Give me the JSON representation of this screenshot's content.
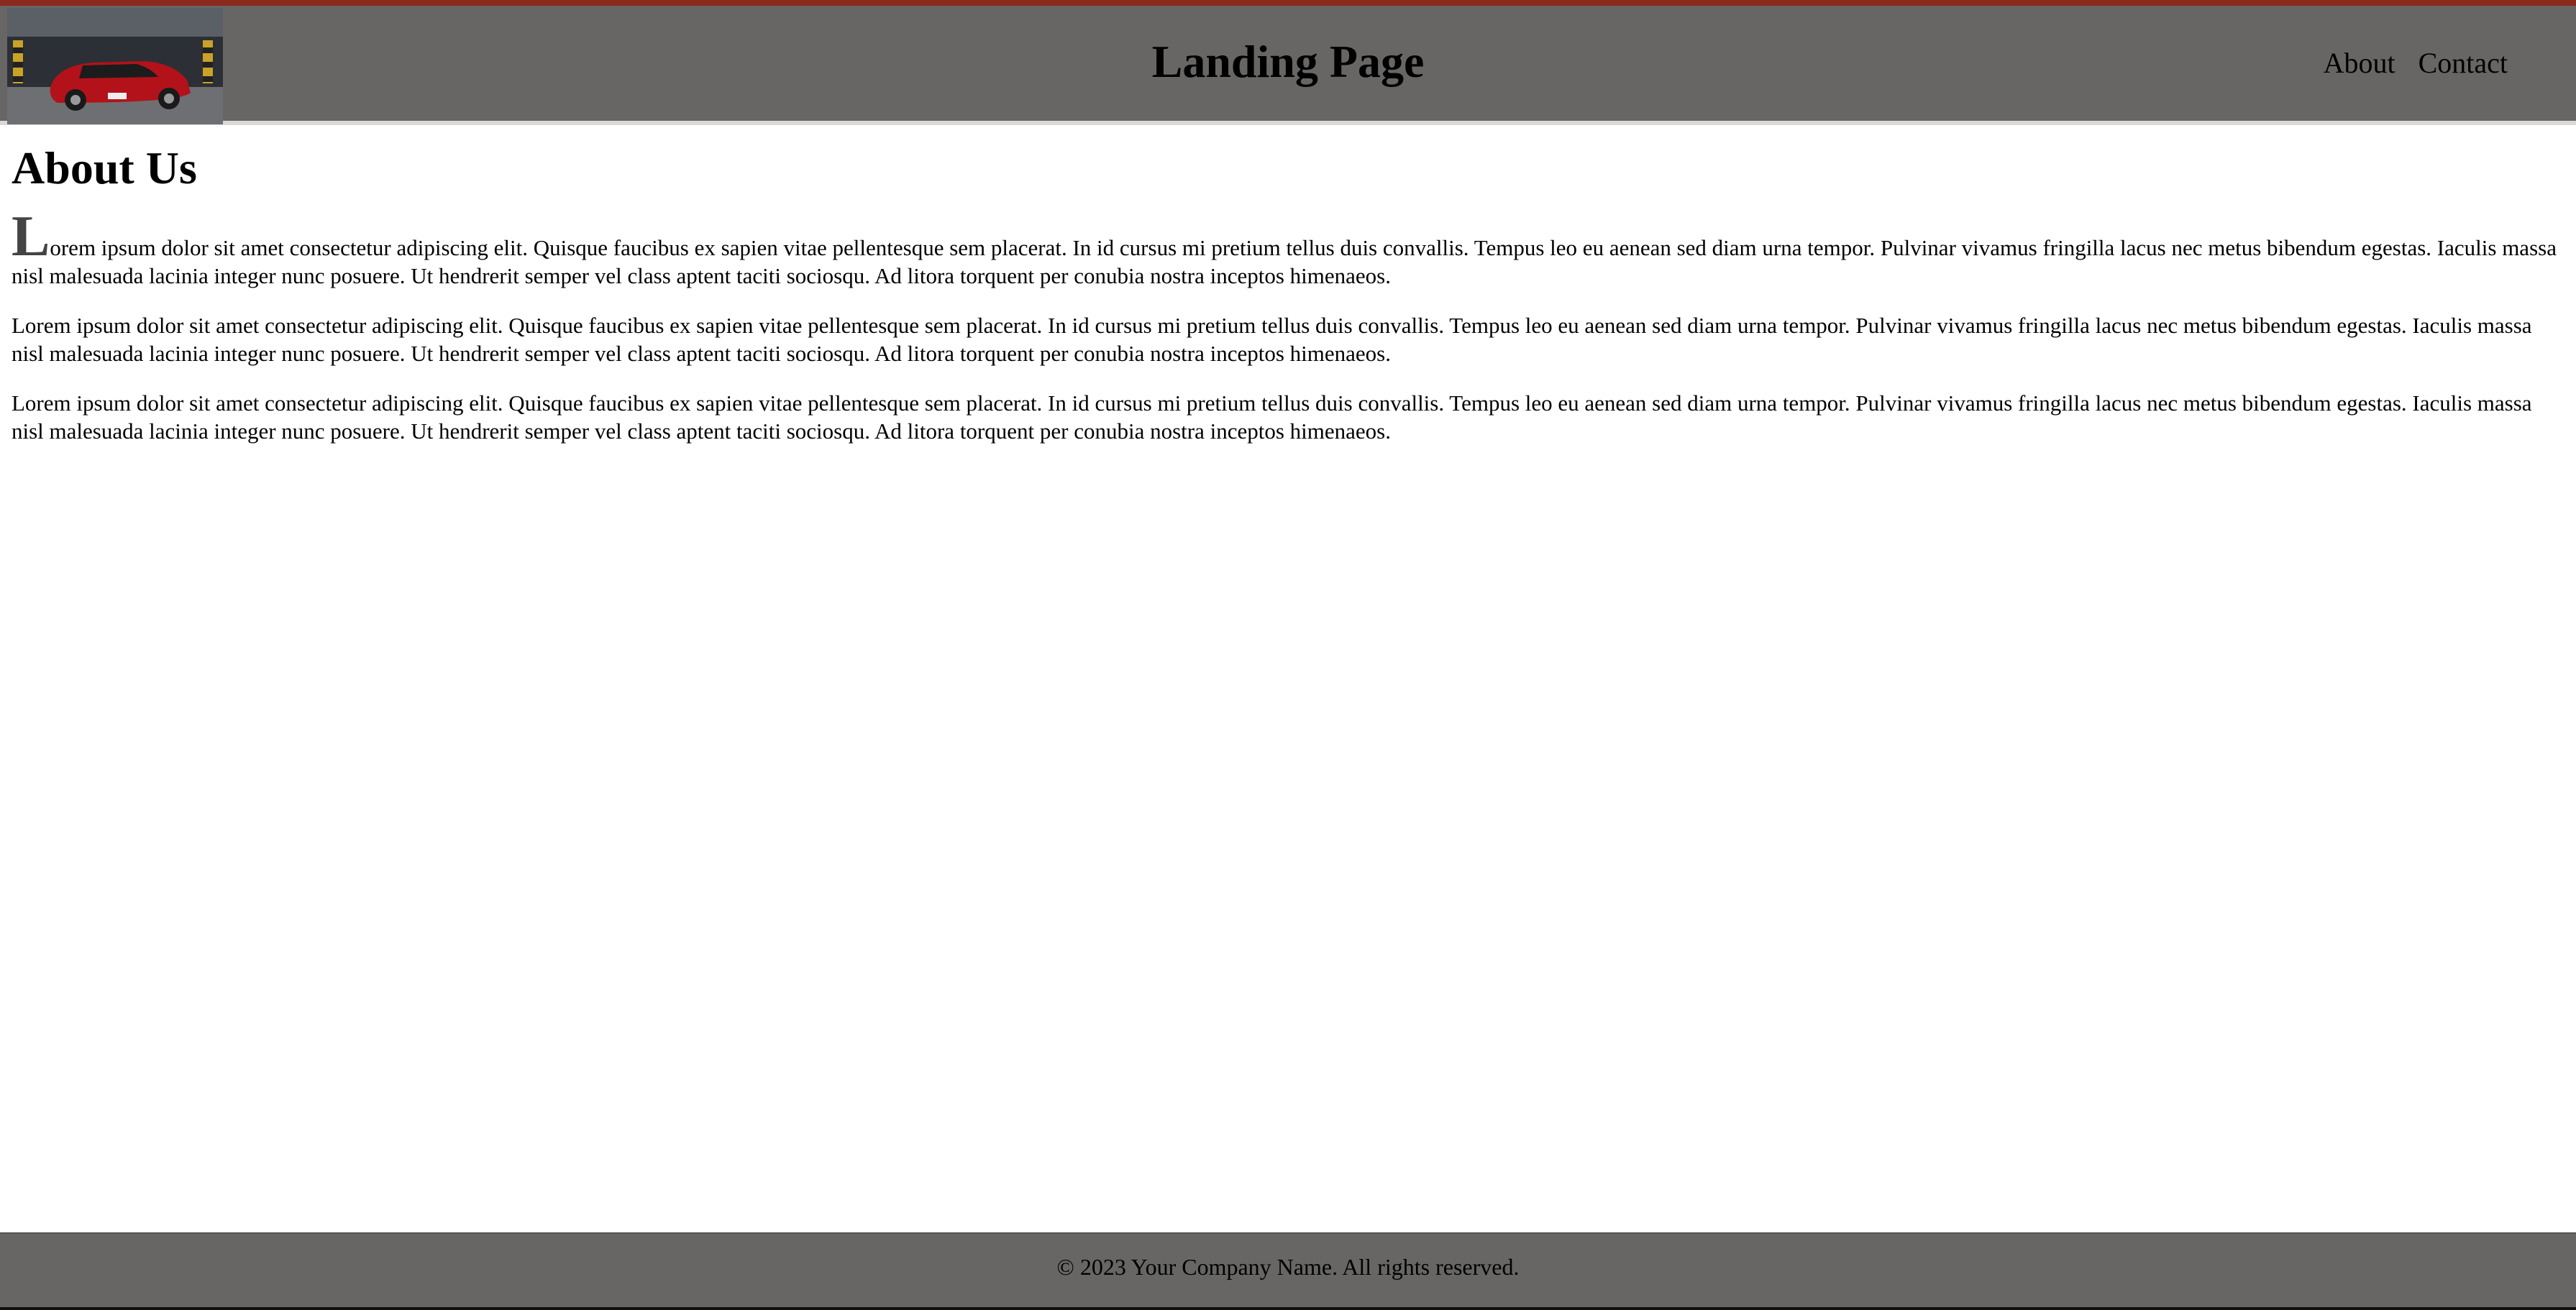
{
  "header": {
    "logo_icon": "car-photo-icon",
    "title": "Landing Page",
    "nav": [
      {
        "label": "About"
      },
      {
        "label": "Contact"
      }
    ]
  },
  "main": {
    "heading": "About Us",
    "paragraphs": [
      "Lorem ipsum dolor sit amet consectetur adipiscing elit. Quisque faucibus ex sapien vitae pellentesque sem placerat. In id cursus mi pretium tellus duis convallis. Tempus leo eu aenean sed diam urna tempor. Pulvinar vivamus fringilla lacus nec metus bibendum egestas. Iaculis massa nisl malesuada lacinia integer nunc posuere. Ut hendrerit semper vel class aptent taciti sociosqu. Ad litora torquent per conubia nostra inceptos himenaeos.",
      "Lorem ipsum dolor sit amet consectetur adipiscing elit. Quisque faucibus ex sapien vitae pellentesque sem placerat. In id cursus mi pretium tellus duis convallis. Tempus leo eu aenean sed diam urna tempor. Pulvinar vivamus fringilla lacus nec metus bibendum egestas. Iaculis massa nisl malesuada lacinia integer nunc posuere. Ut hendrerit semper vel class aptent taciti sociosqu. Ad litora torquent per conubia nostra inceptos himenaeos.",
      "Lorem ipsum dolor sit amet consectetur adipiscing elit. Quisque faucibus ex sapien vitae pellentesque sem placerat. In id cursus mi pretium tellus duis convallis. Tempus leo eu aenean sed diam urna tempor. Pulvinar vivamus fringilla lacus nec metus bibendum egestas. Iaculis massa nisl malesuada lacinia integer nunc posuere. Ut hendrerit semper vel class aptent taciti sociosqu. Ad litora torquent per conubia nostra inceptos himenaeos."
    ]
  },
  "footer": {
    "text": "© 2023 Your Company Name. All rights reserved."
  },
  "colors": {
    "accent": "#8b2a1c",
    "header_bg": "#676665",
    "footer_bg": "#676665"
  }
}
